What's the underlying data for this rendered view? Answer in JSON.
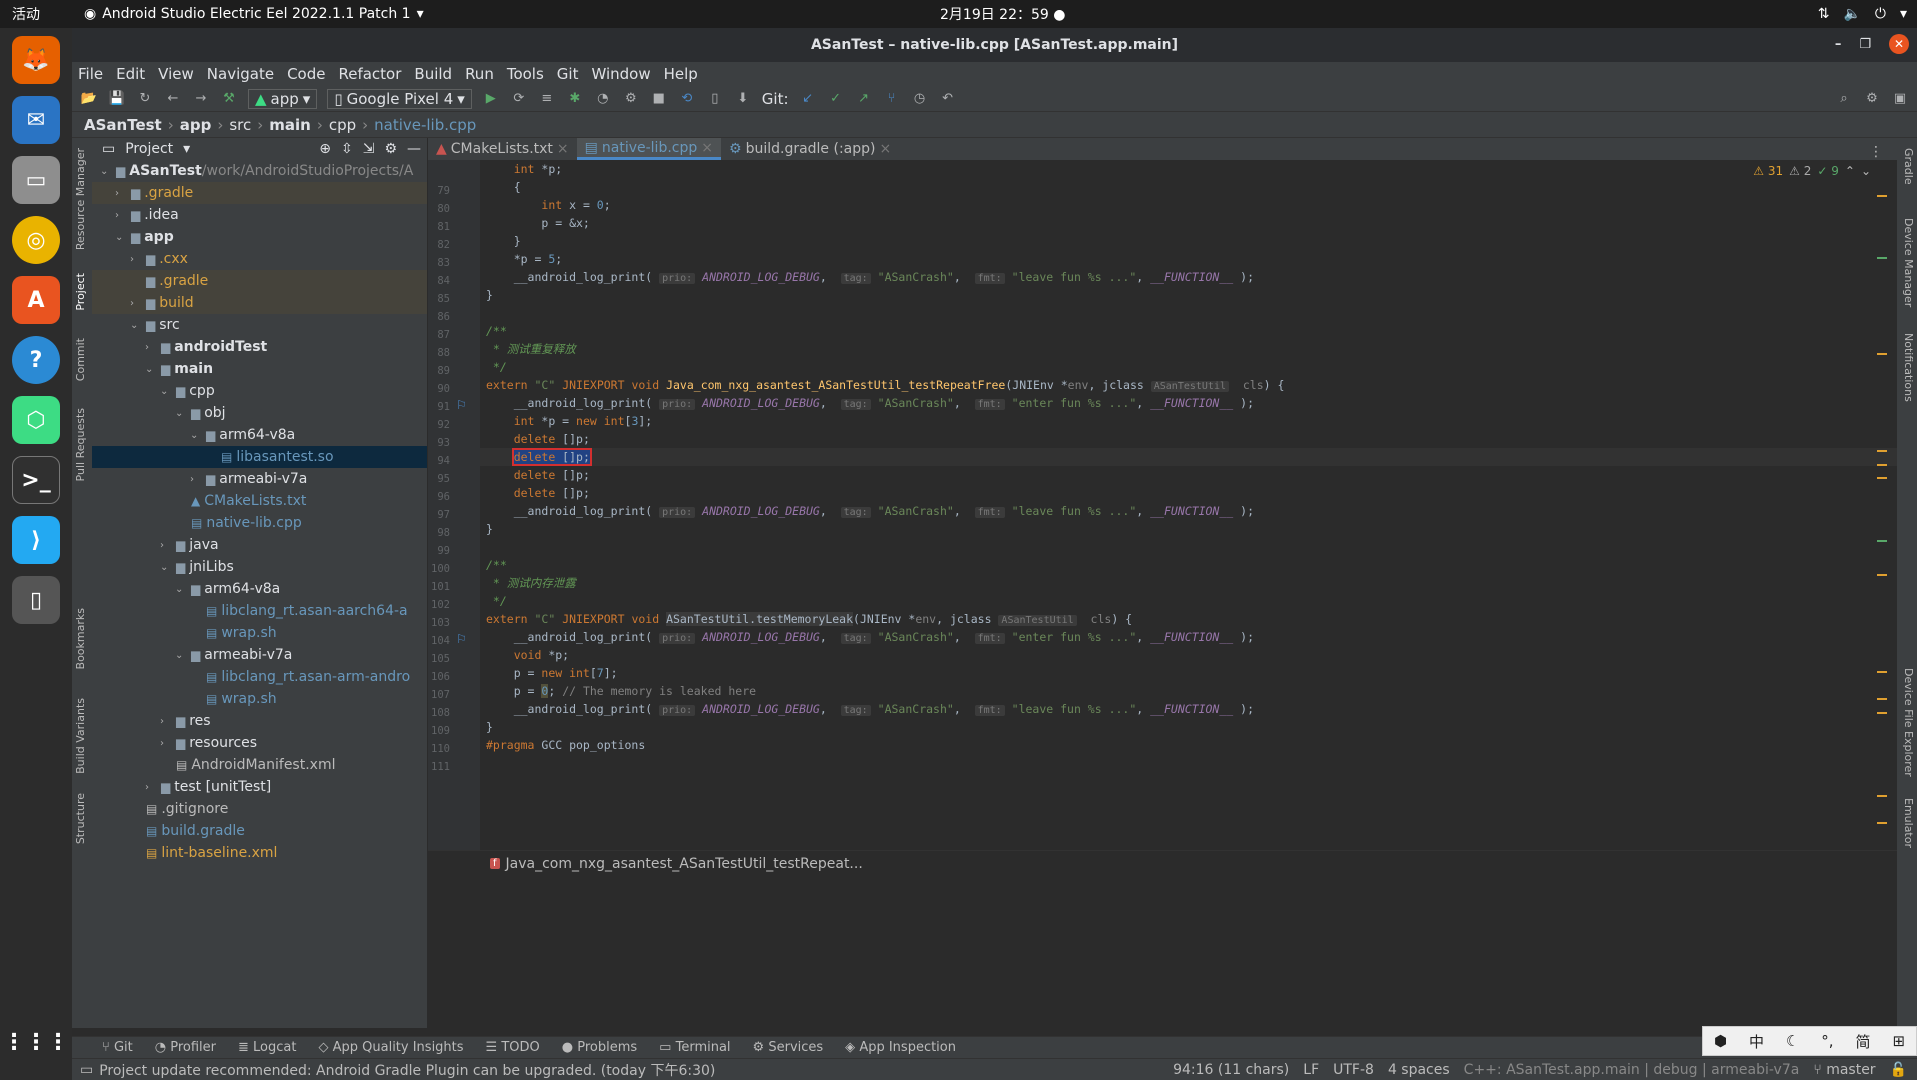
{
  "os_topbar": {
    "activities": "活动",
    "app_name": "Android Studio Electric Eel 2022.1.1 Patch 1",
    "clock": "2月19日 22：59",
    "dot": "●"
  },
  "window": {
    "title": "ASanTest – native-lib.cpp [ASanTest.app.main]"
  },
  "menu": [
    "File",
    "Edit",
    "View",
    "Navigate",
    "Code",
    "Refactor",
    "Build",
    "Run",
    "Tools",
    "Git",
    "Window",
    "Help"
  ],
  "toolbar": {
    "config": "app",
    "device": "Google Pixel 4",
    "git_label": "Git:"
  },
  "breadcrumb": [
    "ASanTest",
    "app",
    "src",
    "main",
    "cpp",
    "native-lib.cpp"
  ],
  "project_pane": {
    "title": "Project",
    "tree": [
      {
        "label": "ASanTest",
        "extra": " /work/AndroidStudioProjects/A",
        "depth": 0,
        "arrow": "⌄",
        "kind": "module",
        "bold": true
      },
      {
        "label": ".gradle",
        "depth": 1,
        "arrow": "›",
        "kind": "folder-orange",
        "hl": true
      },
      {
        "label": ".idea",
        "depth": 1,
        "arrow": "›",
        "kind": "folder"
      },
      {
        "label": "app",
        "depth": 1,
        "arrow": "⌄",
        "kind": "module",
        "bold": true
      },
      {
        "label": ".cxx",
        "depth": 2,
        "arrow": "›",
        "kind": "folder-orange"
      },
      {
        "label": ".gradle",
        "depth": 2,
        "arrow": "",
        "kind": "folder-orange",
        "hl": true
      },
      {
        "label": "build",
        "depth": 2,
        "arrow": "›",
        "kind": "folder-orange",
        "hl": true
      },
      {
        "label": "src",
        "depth": 2,
        "arrow": "⌄",
        "kind": "folder"
      },
      {
        "label": "androidTest",
        "depth": 3,
        "arrow": "›",
        "kind": "folder",
        "bold": true
      },
      {
        "label": "main",
        "depth": 3,
        "arrow": "⌄",
        "kind": "folder",
        "bold": true
      },
      {
        "label": "cpp",
        "depth": 4,
        "arrow": "⌄",
        "kind": "folder"
      },
      {
        "label": "obj",
        "depth": 5,
        "arrow": "⌄",
        "kind": "folder"
      },
      {
        "label": "arm64-v8a",
        "depth": 6,
        "arrow": "⌄",
        "kind": "folder"
      },
      {
        "label": "libasantest.so",
        "depth": 7,
        "arrow": "",
        "kind": "file-blue",
        "selected": true
      },
      {
        "label": "armeabi-v7a",
        "depth": 6,
        "arrow": "›",
        "kind": "folder"
      },
      {
        "label": "CMakeLists.txt",
        "depth": 5,
        "arrow": "",
        "kind": "cmake"
      },
      {
        "label": "native-lib.cpp",
        "depth": 5,
        "arrow": "",
        "kind": "file-blue"
      },
      {
        "label": "java",
        "depth": 4,
        "arrow": "›",
        "kind": "folder"
      },
      {
        "label": "jniLibs",
        "depth": 4,
        "arrow": "⌄",
        "kind": "folder"
      },
      {
        "label": "arm64-v8a",
        "depth": 5,
        "arrow": "⌄",
        "kind": "folder"
      },
      {
        "label": "libclang_rt.asan-aarch64-a",
        "depth": 6,
        "arrow": "",
        "kind": "file-blue"
      },
      {
        "label": "wrap.sh",
        "depth": 6,
        "arrow": "",
        "kind": "file-blue"
      },
      {
        "label": "armeabi-v7a",
        "depth": 5,
        "arrow": "⌄",
        "kind": "folder"
      },
      {
        "label": "libclang_rt.asan-arm-andro",
        "depth": 6,
        "arrow": "",
        "kind": "file-blue"
      },
      {
        "label": "wrap.sh",
        "depth": 6,
        "arrow": "",
        "kind": "file-blue"
      },
      {
        "label": "res",
        "depth": 4,
        "arrow": "›",
        "kind": "folder"
      },
      {
        "label": "resources",
        "depth": 4,
        "arrow": "›",
        "kind": "folder"
      },
      {
        "label": "AndroidManifest.xml",
        "depth": 4,
        "arrow": "",
        "kind": "file"
      },
      {
        "label": "test [unitTest]",
        "depth": 3,
        "arrow": "›",
        "kind": "folder"
      },
      {
        "label": ".gitignore",
        "depth": 2,
        "arrow": "",
        "kind": "file"
      },
      {
        "label": "build.gradle",
        "depth": 2,
        "arrow": "",
        "kind": "file-blue"
      },
      {
        "label": "lint-baseline.xml",
        "depth": 2,
        "arrow": "",
        "kind": "file-orange"
      }
    ]
  },
  "left_tool_tabs": [
    "Resource Manager",
    "Project",
    "Commit",
    "Pull Requests",
    "Bookmarks",
    "Build Variants",
    "Structure"
  ],
  "right_tool_tabs": [
    "Gradle",
    "Device Manager",
    "Notifications",
    "Device File Explorer",
    "Emulator"
  ],
  "editor_tabs": [
    {
      "label": "CMakeLists.txt",
      "active": false
    },
    {
      "label": "native-lib.cpp",
      "active": true
    },
    {
      "label": "build.gradle (:app)",
      "active": false
    }
  ],
  "inspections": {
    "warnings": "31",
    "weak": "2",
    "ok": "9"
  },
  "code_lines": [
    {
      "n": "79",
      "html": "    <span class=\"kw\">int</span> *p;"
    },
    {
      "n": "80",
      "html": "    {"
    },
    {
      "n": "81",
      "html": "        <span class=\"kw\">int</span> x = <span class=\"num\">0</span>;"
    },
    {
      "n": "82",
      "html": "        p = &amp;x;"
    },
    {
      "n": "83",
      "html": "    }"
    },
    {
      "n": "84",
      "html": "    *p = <span class=\"num\">5</span>;"
    },
    {
      "n": "85",
      "html": "    __android_log_print( <span class=\"hint\">prio:</span> <span class=\"macro\">ANDROID_LOG_DEBUG</span>,  <span class=\"hint\">tag:</span> <span class=\"str\">\"ASanCrash\"</span>,  <span class=\"hint\">fmt:</span> <span class=\"str\">\"leave fun %s ...\"</span>, <span class=\"macro\">__FUNCTION__</span> );"
    },
    {
      "n": "86",
      "html": "}"
    },
    {
      "n": "87",
      "html": ""
    },
    {
      "n": "88",
      "html": "<span class=\"cmt\">/**</span>"
    },
    {
      "n": "89",
      "html": "<span class=\"cmt\"> * 测试重复释放</span>"
    },
    {
      "n": "90",
      "html": "<span class=\"cmt\"> */</span>"
    },
    {
      "n": "91",
      "html": "<span class=\"kw\">extern</span> <span class=\"str\">\"C\"</span> <span class=\"kw\">JNIEXPORT void</span> <span class=\"fn\">Java_com_nxg_asantest_ASanTestUtil_testRepeatFree</span>(JNIEnv *<span class=\"cmt2\">env</span>, jclass <span class=\"hint\">ASanTestUtil</span>  <span class=\"cmt2\">cls</span>) {"
    },
    {
      "n": "92",
      "html": "    __android_log_print( <span class=\"hint\">prio:</span> <span class=\"macro\">ANDROID_LOG_DEBUG</span>,  <span class=\"hint\">tag:</span> <span class=\"str\">\"ASanCrash\"</span>,  <span class=\"hint\">fmt:</span> <span class=\"str\">\"enter fun %s ...\"</span>, <span class=\"macro\">__FUNCTION__</span> );"
    },
    {
      "n": "93",
      "html": "    <span class=\"kw\">int</span> *p = <span class=\"kw\">new int</span>[<span class=\"num\">3</span>];"
    },
    {
      "n": "94",
      "html": "    <span class=\"kw\">delete</span> []p;"
    },
    {
      "n": "95",
      "html": "    <span style=\"outline:2px solid #d32f2f;background:#214283\"><span class=\"kw\">delete</span> []p;</span>",
      "current": true
    },
    {
      "n": "96",
      "html": "    <span class=\"kw\">delete</span> []p;"
    },
    {
      "n": "97",
      "html": "    <span class=\"kw\">delete</span> []p;"
    },
    {
      "n": "98",
      "html": "    __android_log_print( <span class=\"hint\">prio:</span> <span class=\"macro\">ANDROID_LOG_DEBUG</span>,  <span class=\"hint\">tag:</span> <span class=\"str\">\"ASanCrash\"</span>,  <span class=\"hint\">fmt:</span> <span class=\"str\">\"leave fun %s ...\"</span>, <span class=\"macro\">__FUNCTION__</span> );"
    },
    {
      "n": "99",
      "html": "}"
    },
    {
      "n": "100",
      "html": ""
    },
    {
      "n": "101",
      "html": "<span class=\"cmt\">/**</span>"
    },
    {
      "n": "102",
      "html": "<span class=\"cmt\"> * 测试内存泄露</span>"
    },
    {
      "n": "103",
      "html": "<span class=\"cmt\"> */</span>"
    },
    {
      "n": "104",
      "html": "<span class=\"kw\">extern</span> <span class=\"str\">\"C\"</span> <span class=\"kw\">JNIEXPORT void</span> <span style=\"background:#3b3b3b\">ASanTestUtil.testMemoryLeak</span>(JNIEnv *<span class=\"cmt2\">env</span>, jclass <span class=\"hint\">ASanTestUtil</span>  <span class=\"cmt2\">cls</span>) {"
    },
    {
      "n": "105",
      "html": "    __android_log_print( <span class=\"hint\">prio:</span> <span class=\"macro\">ANDROID_LOG_DEBUG</span>,  <span class=\"hint\">tag:</span> <span class=\"str\">\"ASanCrash\"</span>,  <span class=\"hint\">fmt:</span> <span class=\"str\">\"enter fun %s ...\"</span>, <span class=\"macro\">__FUNCTION__</span> );"
    },
    {
      "n": "106",
      "html": "    <span class=\"kw\">void</span> *p;"
    },
    {
      "n": "107",
      "html": "    p = <span class=\"kw\">new int</span>[<span class=\"num\">7</span>];"
    },
    {
      "n": "108",
      "html": "    p = <span class=\"num\" style=\"background:#52503a\">0</span>; <span class=\"cmt2\">// The memory is leaked here</span>"
    },
    {
      "n": "109",
      "html": "    __android_log_print( <span class=\"hint\">prio:</span> <span class=\"macro\">ANDROID_LOG_DEBUG</span>,  <span class=\"hint\">tag:</span> <span class=\"str\">\"ASanCrash\"</span>,  <span class=\"hint\">fmt:</span> <span class=\"str\">\"leave fun %s ...\"</span>, <span class=\"macro\">__FUNCTION__</span> );"
    },
    {
      "n": "110",
      "html": "}"
    },
    {
      "n": "111",
      "html": "<span class=\"kw\">#pragma</span> GCC pop_options"
    }
  ],
  "editor_breadcrumb": "Java_com_nxg_asantest_ASanTestUtil_testRepeat...",
  "tool_windows": [
    "Git",
    "Profiler",
    "Logcat",
    "App Quality Insights",
    "TODO",
    "Problems",
    "Terminal",
    "Services",
    "App Inspection"
  ],
  "status": {
    "message": "Project update recommended: Android Gradle Plugin can be upgraded. (today 下午6:30)",
    "position": "94:16 (11 chars)",
    "line_sep": "LF",
    "encoding": "UTF-8",
    "indent": "4 spaces",
    "context": "C++: ASanTest.app.main | debug | armeabi-v7a",
    "branch": "master"
  },
  "ime": [
    "中",
    "简"
  ]
}
